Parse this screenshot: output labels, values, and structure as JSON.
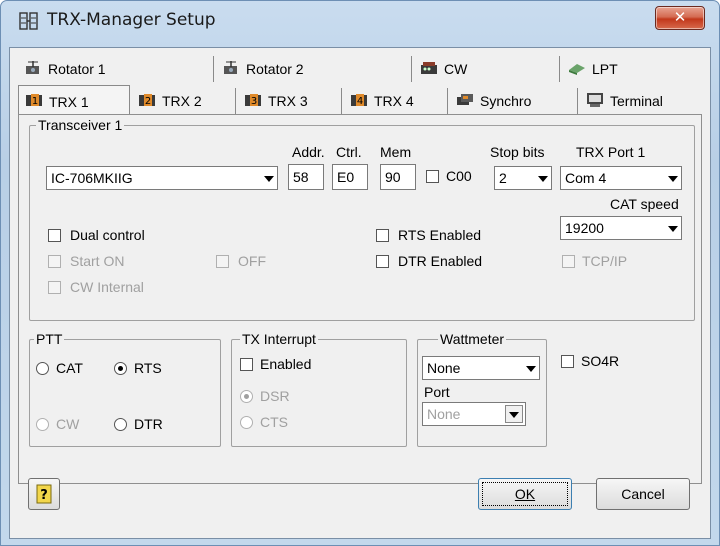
{
  "window": {
    "title": "TRX-Manager Setup",
    "close_glyph": "✕"
  },
  "tabs_back": [
    {
      "label": "Rotator 1",
      "icon": "rotator-icon"
    },
    {
      "label": "Rotator 2",
      "icon": "rotator-icon"
    },
    {
      "label": "CW",
      "icon": "cw-keyer-icon"
    },
    {
      "label": "LPT",
      "icon": "lpt-port-icon"
    }
  ],
  "tabs_front": [
    {
      "label": "TRX 1",
      "icon": "trx1-icon",
      "active": true
    },
    {
      "label": "TRX 2",
      "icon": "trx2-icon"
    },
    {
      "label": "TRX 3",
      "icon": "trx3-icon"
    },
    {
      "label": "TRX 4",
      "icon": "trx4-icon"
    },
    {
      "label": "Synchro",
      "icon": "synchro-icon"
    },
    {
      "label": "Terminal",
      "icon": "terminal-icon"
    }
  ],
  "transceiver": {
    "group_label": "Transceiver 1",
    "model_value": "IC-706MKIIG",
    "addr_label": "Addr.",
    "addr_value": "58",
    "ctrl_label": "Ctrl.",
    "ctrl_value": "E0",
    "mem_label": "Mem",
    "mem_value": "90",
    "c00_label": "C00",
    "stopbits_label": "Stop bits",
    "stopbits_value": "2",
    "trxport_label": "TRX Port 1",
    "trxport_value": "Com 4",
    "catspeed_label": "CAT speed",
    "catspeed_value": "19200",
    "dual_control": "Dual control",
    "start_on": "Start ON",
    "off": "OFF",
    "cw_internal": "CW Internal",
    "rts_enabled": "RTS Enabled",
    "dtr_enabled": "DTR Enabled",
    "tcpip": "TCP/IP"
  },
  "ptt": {
    "group_label": "PTT",
    "cat": "CAT",
    "rts": "RTS",
    "cw": "CW",
    "dtr": "DTR",
    "selected": "RTS"
  },
  "tx_interrupt": {
    "group_label": "TX Interrupt",
    "enabled": "Enabled",
    "dsr": "DSR",
    "cts": "CTS"
  },
  "wattmeter": {
    "group_label": "Wattmeter",
    "value": "None",
    "port_label": "Port",
    "port_value": "None"
  },
  "so4r_label": "SO4R",
  "buttons": {
    "help_glyph": "?",
    "ok": "OK",
    "cancel": "Cancel"
  },
  "colors": {
    "title_gradient": "#c3d8ec",
    "close_button": "#c2381b",
    "client_bg": "#f0f0f0"
  }
}
